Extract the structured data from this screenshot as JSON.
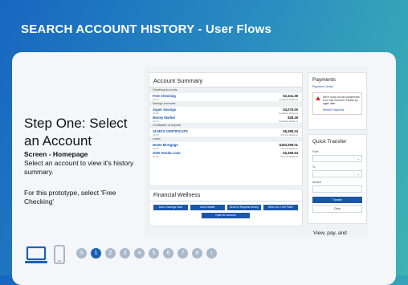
{
  "header": {
    "title": "SEARCH ACCOUNT HISTORY  - User Flows"
  },
  "step": {
    "title": "Step One: Select an Account",
    "screen": "Screen - Homepage",
    "description": "Select an account to view it's history summary.",
    "note": "For this prototype, select 'Free Checking'"
  },
  "devices": {
    "laptop": "laptop-icon",
    "phone": "phone-icon"
  },
  "pager": {
    "items": [
      "S",
      "1",
      "2",
      "3",
      "4",
      "5",
      "6",
      "7",
      "8",
      "i"
    ],
    "active_index": 1
  },
  "mock": {
    "account_summary": {
      "title": "Account Summary",
      "sections": [
        {
          "label": "Checking Accounts",
          "rows": [
            {
              "name": "Free Checking",
              "sub": "x6-05",
              "amount": "$2,341.39",
              "amount_label": "Available Balance"
            }
          ]
        },
        {
          "label": "Savings Accounts",
          "rows": [
            {
              "name": "Super Savings",
              "sub": "x6-00",
              "amount": "$3,270.00",
              "amount_label": "Available Balance"
            },
            {
              "name": "Money Market",
              "sub": "x6-04",
              "amount": "$28.29",
              "amount_label": "Available Balance"
            }
          ]
        },
        {
          "label": "Certificates of Deposit",
          "rows": [
            {
              "name": "18 MOS CERTIFICATE",
              "sub": "x6-20",
              "amount": "$5,385.24",
              "amount_label": "Current Balance"
            }
          ]
        },
        {
          "label": "Loans",
          "rows": [
            {
              "name": "Home Mortgage",
              "sub": "x6-02",
              "amount": "$183,399.01",
              "amount_label": "Current Balance"
            },
            {
              "name": "2020 Honda Loan",
              "sub": "x6-48",
              "amount": "$2,466.54",
              "amount_label": "Current Balance"
            }
          ]
        }
      ]
    },
    "financial_wellness": {
      "title": "Financial Wellness",
      "buttons": [
        "Add a Savings Goal",
        "Card Details",
        "Send Or Request Money",
        "When Do I Get Paid?"
      ],
      "open_account": "Open An Account"
    },
    "payments": {
      "title": "Payments",
      "link": "Payment Center",
      "alert": "We're sorry, but an unexpected error has occurred. Please try again later.",
      "alert_link": "Refresh Payments"
    },
    "quick_transfer": {
      "title": "Quick Transfer",
      "from_label": "From",
      "to_label": "To",
      "amount_label": "Amount",
      "transfer_button": "Transfer",
      "clear_button": "Clear"
    },
    "promo_text": "View, pay, and manage your credit"
  },
  "colors": {
    "accent": "#1b5fb4",
    "link": "#1a56a8"
  }
}
